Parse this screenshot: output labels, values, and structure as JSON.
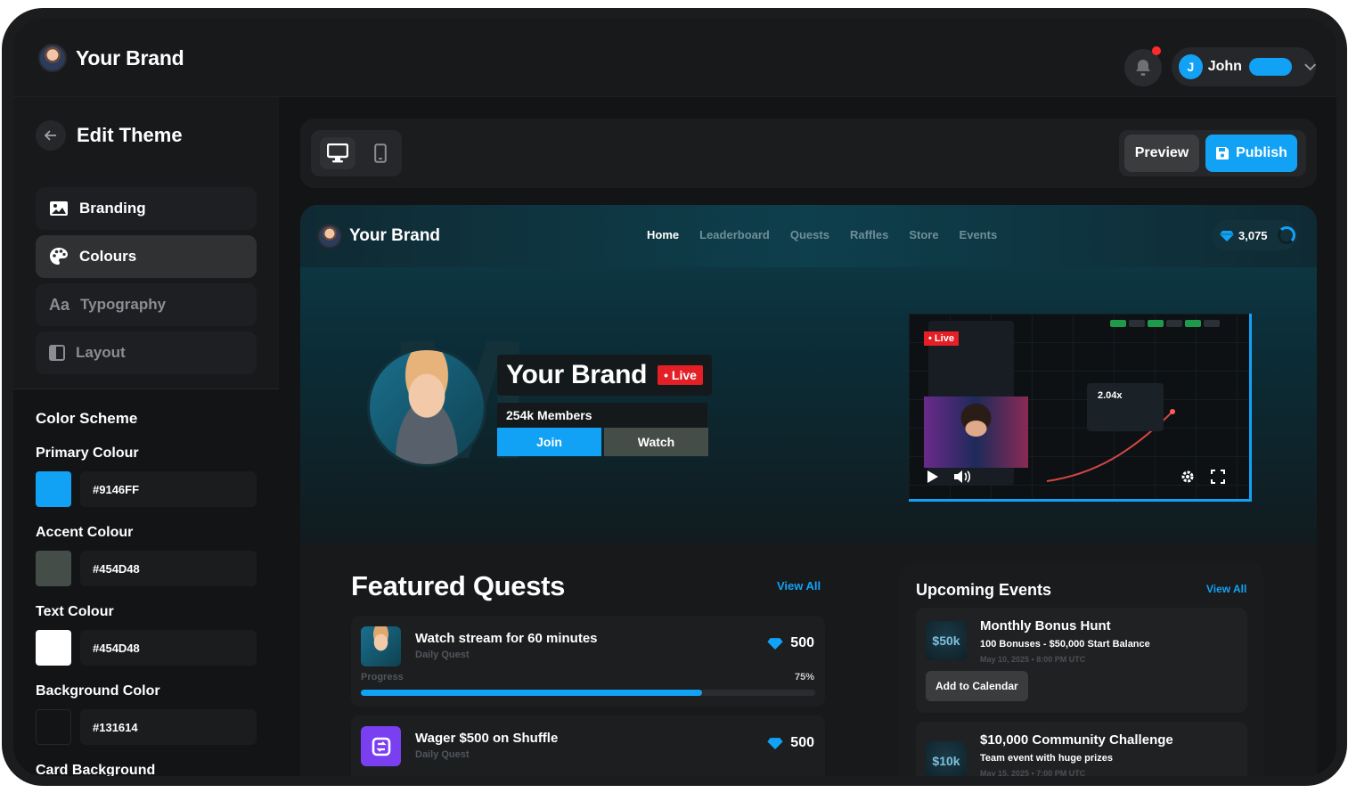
{
  "app": {
    "brand_name": "Your Brand",
    "user_initial": "J",
    "user_name": "John"
  },
  "sidebar": {
    "title": "Edit Theme",
    "items": [
      {
        "label": "Branding",
        "icon": "image-icon"
      },
      {
        "label": "Colours",
        "icon": "palette-icon"
      },
      {
        "label": "Aa",
        "icon": "typography-icon",
        "label2": "Typography"
      },
      {
        "label": "Layout",
        "icon": "layout-icon"
      }
    ],
    "color_scheme_label": "Color Scheme",
    "colors": [
      {
        "label": "Primary Colour",
        "value": "#9146FF",
        "swatch": "#12a2f5"
      },
      {
        "label": "Accent Colour",
        "value": "#454D48",
        "swatch": "#454d48"
      },
      {
        "label": "Text Colour",
        "value": "#454D48",
        "swatch": "#ffffff"
      },
      {
        "label": "Background Color",
        "value": "#131614",
        "swatch": "#131416"
      }
    ],
    "card_background_label": "Card Background"
  },
  "toolbar": {
    "preview_label": "Preview",
    "publish_label": "Publish"
  },
  "site": {
    "brand_name": "Your Brand",
    "nav": [
      "Home",
      "Leaderboard",
      "Quests",
      "Raffles",
      "Store",
      "Events"
    ],
    "gem_balance": "3,075",
    "hero": {
      "title": "Your Brand",
      "live_label": "Live",
      "members": "254k Members",
      "join_label": "Join",
      "watch_label": "Watch"
    },
    "video": {
      "live_label": "Live",
      "multiplier": "2.04x"
    },
    "featured_quests": {
      "title": "Featured Quests",
      "view_all": "View All",
      "items": [
        {
          "name": "Watch stream for 60 minutes",
          "sub": "Daily Quest",
          "reward": "500",
          "progress_label": "Progress",
          "progress_pct": "75%",
          "progress": 0.75
        },
        {
          "name": "Wager $500 on Shuffle",
          "sub": "Daily Quest",
          "reward": "500"
        }
      ]
    },
    "events": {
      "title": "Upcoming Events",
      "view_all": "View All",
      "items": [
        {
          "badge": "$50k",
          "name": "Monthly Bonus Hunt",
          "desc": "100 Bonuses - $50,000 Start Balance",
          "date": "May 10, 2025 • 8:00 PM UTC",
          "cta": "Add to Calendar"
        },
        {
          "badge": "$10k",
          "name": "$10,000 Community Challenge",
          "desc": "Team event with huge prizes",
          "date": "May 15, 2025 • 7:00 PM UTC"
        }
      ]
    }
  },
  "colors": {
    "accent": "#12a2f5",
    "live_red": "#e41f26",
    "background": "#131416"
  }
}
